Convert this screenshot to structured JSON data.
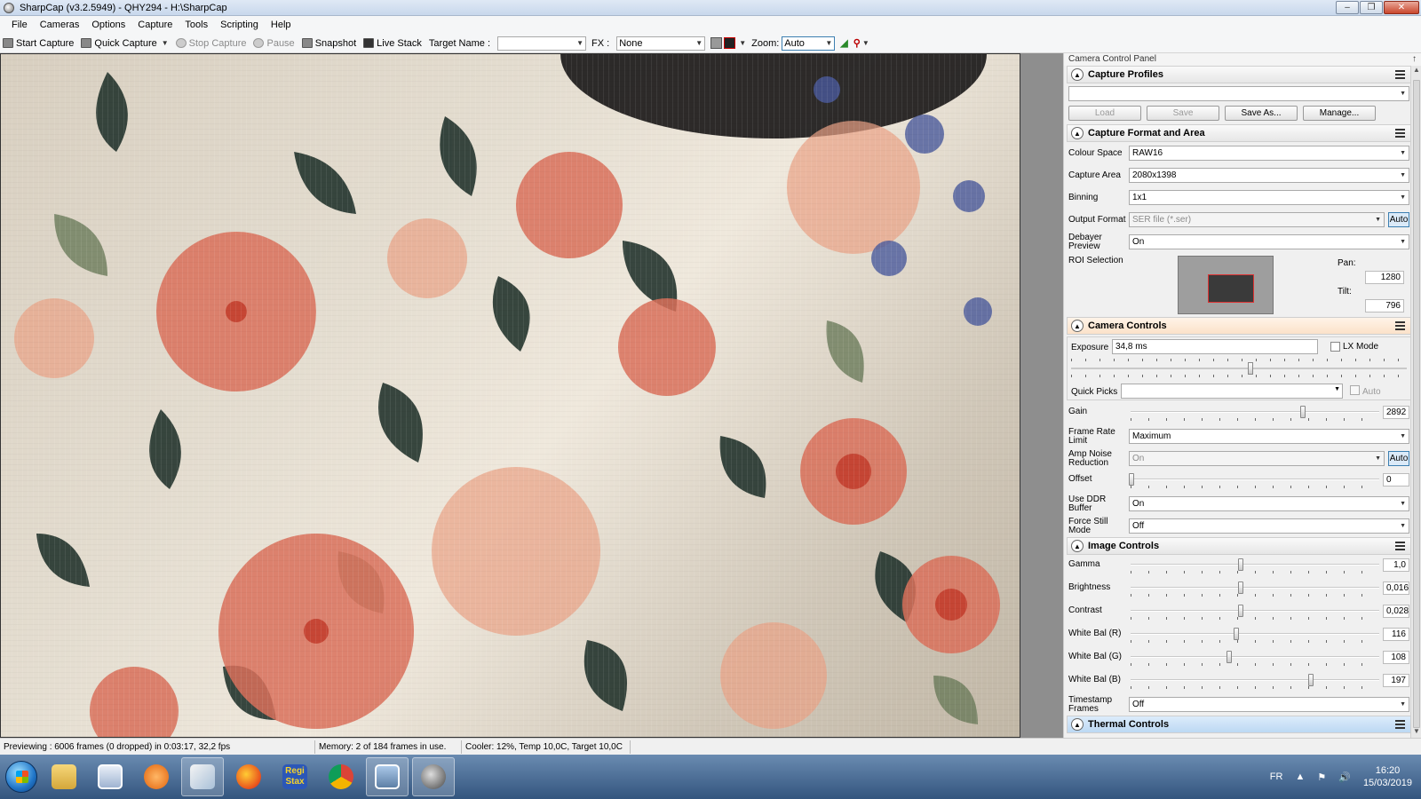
{
  "window": {
    "title": "SharpCap (v3.2.5949) - QHY294 - H:\\SharpCap"
  },
  "menu": [
    "File",
    "Cameras",
    "Options",
    "Capture",
    "Tools",
    "Scripting",
    "Help"
  ],
  "toolbar": {
    "start_capture": "Start Capture",
    "quick_capture": "Quick Capture",
    "stop_capture": "Stop Capture",
    "pause": "Pause",
    "snapshot": "Snapshot",
    "live_stack": "Live Stack",
    "target_name_label": "Target Name :",
    "target_name_value": "",
    "fx_label": "FX :",
    "fx_value": "None",
    "zoom_label": "Zoom:",
    "zoom_value": "Auto"
  },
  "panel": {
    "title": "Camera Control Panel",
    "pin": "↑",
    "capture_profiles": {
      "title": "Capture Profiles",
      "selected": "",
      "load": "Load",
      "save": "Save",
      "save_as": "Save As...",
      "manage": "Manage..."
    },
    "capture_format": {
      "title": "Capture Format and Area",
      "colour_space_label": "Colour Space",
      "colour_space": "RAW16",
      "capture_area_label": "Capture Area",
      "capture_area": "2080x1398",
      "binning_label": "Binning",
      "binning": "1x1",
      "output_format_label": "Output Format",
      "output_format": "SER file (*.ser)",
      "auto": "Auto",
      "debayer_label": "Debayer Preview",
      "debayer": "On",
      "roi_label": "ROI Selection",
      "pan_label": "Pan:",
      "pan": "1280",
      "tilt_label": "Tilt:",
      "tilt": "796"
    },
    "camera_controls": {
      "title": "Camera Controls",
      "exposure_label": "Exposure",
      "exposure": "34,8 ms",
      "lx_mode": "LX Mode",
      "quick_picks_label": "Quick Picks",
      "quick_picks": "",
      "auto": "Auto",
      "gain_label": "Gain",
      "gain": "2892",
      "frame_rate_label": "Frame Rate Limit",
      "frame_rate": "Maximum",
      "amp_noise_label": "Amp Noise Reduction",
      "amp_noise": "On",
      "offset_label": "Offset",
      "offset": "0",
      "ddr_label": "Use DDR Buffer",
      "ddr": "On",
      "force_still_label": "Force Still Mode",
      "force_still": "Off"
    },
    "image_controls": {
      "title": "Image Controls",
      "gamma_label": "Gamma",
      "gamma": "1,0",
      "brightness_label": "Brightness",
      "brightness": "0,016",
      "contrast_label": "Contrast",
      "contrast": "0,028",
      "wb_r_label": "White Bal (R)",
      "wb_r": "116",
      "wb_g_label": "White Bal (G)",
      "wb_g": "108",
      "wb_b_label": "White Bal (B)",
      "wb_b": "197",
      "timestamp_label": "Timestamp Frames",
      "timestamp": "Off"
    },
    "thermal": {
      "title": "Thermal Controls"
    }
  },
  "status": {
    "previewing": "Previewing : 6006 frames (0 dropped) in 0:03:17, 32,2 fps",
    "memory": "Memory: 2 of 184 frames in use.",
    "cooler": "Cooler: 12%, Temp 10,0C, Target 10,0C"
  },
  "taskbar": {
    "apps": [
      "start-menu",
      "file-explorer",
      "image-viewer",
      "media-player",
      "sharpcap-alt",
      "firefox",
      "registax",
      "chrome",
      "photos",
      "sharpcap"
    ],
    "registax_label": "Regi\nStax",
    "tray_lang": "FR",
    "time": "16:20",
    "date": "15/03/2019"
  }
}
